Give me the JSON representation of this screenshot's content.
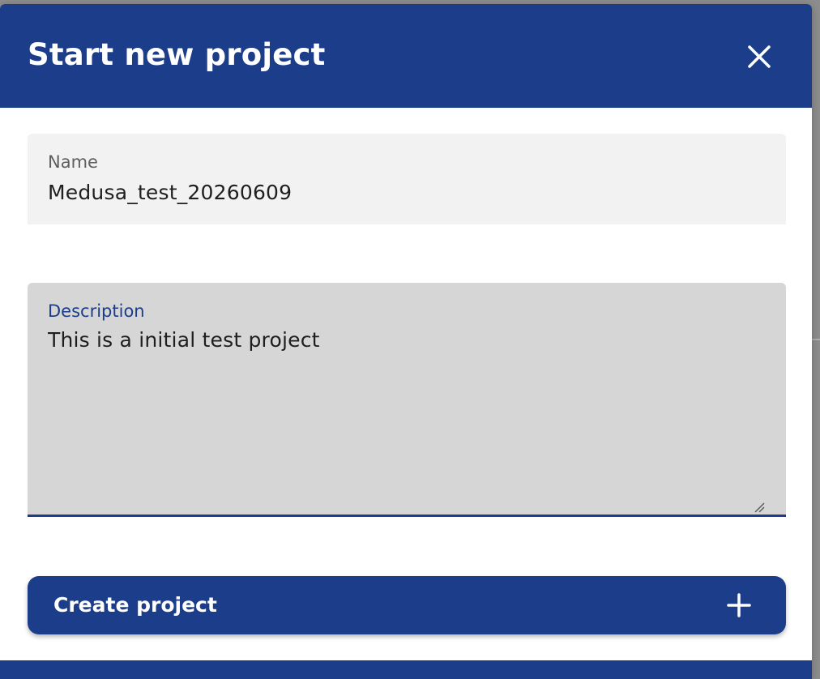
{
  "dialog": {
    "title": "Start new project",
    "close_icon": "close-icon"
  },
  "form": {
    "name": {
      "label": "Name",
      "value": "Medusa_test_20260609"
    },
    "description": {
      "label": "Description",
      "value": "This is a initial test project"
    }
  },
  "actions": {
    "create_label": "Create project",
    "create_icon": "plus-icon"
  },
  "colors": {
    "brand": "#1b3d8a",
    "name_field_bg": "#f2f2f2",
    "description_field_bg": "#d6d6d6",
    "overlay": "#8d8d8d"
  }
}
